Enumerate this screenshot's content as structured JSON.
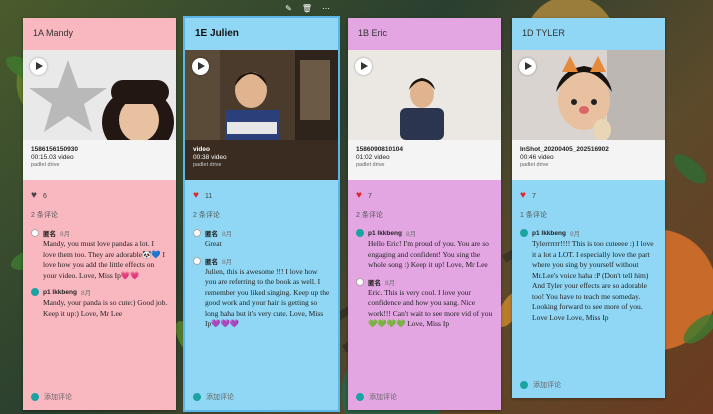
{
  "columns": [
    {
      "id": "mandy",
      "header": "1A Mandy",
      "bg": "#f9b7c0",
      "video_title": "1586156150930",
      "duration": "00:15.03 video",
      "source": "padlet drive",
      "likes": "6",
      "comments_count": "2 条评论",
      "comments": [
        {
          "author": "匿名",
          "date": "8月",
          "text": "Mandy, you must love pandas a lot. I love them too. They are adorable🐼💙 I love how you add the little effects on your video. Love, Miss Ip💗💗"
        },
        {
          "author": "p1 lkkbeng",
          "date": "8月",
          "text": "Mandy, your panda is so cute:) Good job. Keep it up:) Love, Mr Lee"
        }
      ],
      "add_comment": "添加评论"
    },
    {
      "id": "julien",
      "header": "1E Julien",
      "bg": "#8fd7f4",
      "video_title": "video",
      "duration": "00:38 video",
      "source": "padlet drive",
      "likes": "11",
      "comments_count": "2 条评论",
      "comments": [
        {
          "author": "匿名",
          "date": "8月",
          "text": "Great"
        },
        {
          "author": "匿名",
          "date": "8月",
          "text": "Julien, this is awesome !!! I love how you are referring to the book as well. I remember you liked singing. Keep up the good work and your hair is getting so long haha but it's very cute. Love, Miss Ip💜💜💜"
        }
      ],
      "add_comment": "添加评论"
    },
    {
      "id": "eric",
      "header": "1B Eric",
      "bg": "#e3a6e3",
      "video_title": "1586090810104",
      "duration": "01:02 video",
      "source": "padlet drive",
      "likes": "7",
      "comments_count": "2 条评论",
      "comments": [
        {
          "author": "p1 lkkbeng",
          "date": "8月",
          "text": "Hello Eric! I'm proud of you. You are so engaging and confident! You sing the whole song :) Keep it up! Love, Mr Lee"
        },
        {
          "author": "匿名",
          "date": "8月",
          "text": "Eric. This is very cool. I love your confidence and how you sang. Nice work!!! Can't wait to see more vid of you💚💚💚💚 Love, Miss Ip"
        }
      ],
      "add_comment": "添加评论"
    },
    {
      "id": "tyler",
      "header": "1D TYLER",
      "bg": "#8fd7f4",
      "video_title": "InShot_20200405_202516902",
      "duration": "00:46 video",
      "source": "padlet drive",
      "likes": "7",
      "comments_count": "1 条评论",
      "comments": [
        {
          "author": "p1 lkkbeng",
          "date": "8月",
          "text": "Tylerrrrrr!!!! This is too cuteeee :) I love it a lot a LOT. I especially love the part where you sing by yourself without Mr.Lee's voice haha :P (Don't tell him) And Tyler your effects are so adorable too! You have to teach me someday. Looking forward to see more of you. Love Love Love, Miss Ip"
        }
      ],
      "add_comment": "添加评论"
    }
  ],
  "colors": {
    "heart": "#e0252b",
    "avatar": "#1aa3a3"
  },
  "icons": {
    "play": "play-icon",
    "heart": "heart-icon",
    "edit": "pencil-icon",
    "delete": "trash-icon",
    "more": "more-icon"
  }
}
